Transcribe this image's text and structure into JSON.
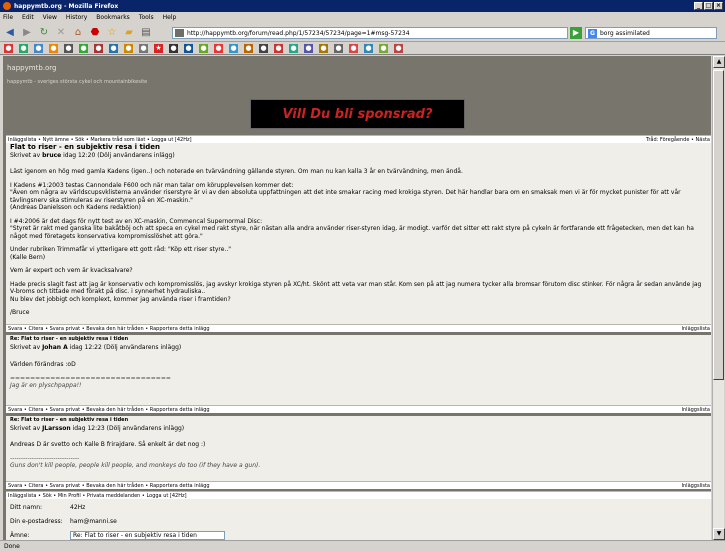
{
  "window": {
    "title": "happymtb.org - Mozilla Firefox",
    "min": "_",
    "max": "□",
    "close": "×"
  },
  "menu": [
    "File",
    "Edit",
    "View",
    "History",
    "Bookmarks",
    "Tools",
    "Help"
  ],
  "nav": {
    "url": "http://happymtb.org/forum/read.php/1/57234/57234/page=1#msg-57234",
    "search": "borg assimilated"
  },
  "site": {
    "title": "happymtb.org",
    "tagline": "happymtb - sveriges största cykel och mountainbikesite"
  },
  "banner": "Vill Du bli sponsrad?",
  "forumbar_top": {
    "left": "Inläggslista • Nytt ämne • Sök • Markera tråd som läst • Logga ut [42Hz]",
    "right": "Tråd: Föregående • Nästa"
  },
  "posts": [
    {
      "subject": "Flat to riser - en subjektiv resa i tiden",
      "by_prefix": "Skrivet av ",
      "author": "bruce",
      "by_suffix": " idag 12:20 (Dölj användarens inlägg)",
      "paragraphs": [
        "Läst igenom en hög med gamla Kadens (igen..) och noterade en tvärvändning gällande styren. Om man nu kan kalla 3 år en tvärvändning, men ändå.",
        "I Kadens #1:2003 testas Cannondale F600 och när man talar om körupplevelsen kommer det:\n\"Även om några av världscupsvklisterna använder riserstyre är vi av den absoluta uppfattningen att det inte smakar racing med krokiga styren. Det här handlar bara om en smaksak men vi är för mycket punister för att vår tävlingsnerv ska stimuleras av riserstyren på en XC-maskin.\"\n(Andreas Danielsson och Kadens redaktion)",
        "I #4:2006 är det dags för nytt test av en XC-maskin, Commencal Supernormal Disc:\n\"Styret är rakt med ganska lite bakåtböj och att speca en cykel med rakt styre, när nästan alla andra använder riser-styren idag, är modigt. varför det sitter ett rakt styre på cykeln är fortfarande ett frågetecken, men det kan ha något med företagets konservativa kompromisslöshet att göra.\"",
        "Under rubriken Trimmafår vi ytterligare ett gott råd: \"Köp ett riser styre..\"\n(Kalle Bern)",
        "Vem är expert och vem är kvacksalvare?",
        "Hade precis slagit fast att jag är konservativ och kompromisslös, jag avskyr krokiga styren på XC/ht. Skönt att veta var man står. Kom sen på att jag numera tycker alla bromsar förutom disc stinker. För några år sedan använde jag V-broms och tittade med förakt på disc. i synnerhet hydrauliska..\nNu blev det jobbigt och komplext, kommer jag använda riser i framtiden?",
        "/Bruce"
      ],
      "sig": "",
      "bar_left": "Svara • Citera • Svara privat • Bevaka den här tråden • Rapportera detta inlägg",
      "bar_right": "Inläggslista"
    },
    {
      "subject": "Re: Flat to riser - en subjektiv resa i tiden",
      "by_prefix": "Skrivet av ",
      "author": "Johan A",
      "by_suffix": " idag 12:22 (Dölj användarens inlägg)",
      "paragraphs": [
        "Världen förändras :oD"
      ],
      "sig": "================================\nJag är en plyschpappa!!",
      "bar_left": "Svara • Citera • Svara privat • Bevaka den här tråden • Rapportera detta inlägg",
      "bar_right": "Inläggslista"
    },
    {
      "subject": "Re: Flat to riser - en subjektiv resa i tiden",
      "by_prefix": "Skrivet av ",
      "author": "JLarsson",
      "by_suffix": " idag 12:23 (Dölj användarens inlägg)",
      "paragraphs": [
        "Andreas D är svetto och Kalle B frirajdare. Så enkelt är det nog :)"
      ],
      "sig": "--------------------------------\nGuns don't kill people, people kill people, and monkeys do too (if they have a gun).",
      "bar_left": "Svara • Citera • Svara privat • Bevaka den här tråden • Rapportera detta inlägg",
      "bar_right": "Inläggslista"
    }
  ],
  "forumbar_bottom": {
    "left": "Inläggslista • Sök • Min Profil • Privata meddelanden • Logga ut [42Hz]"
  },
  "reply": {
    "name_label": "Ditt namn:",
    "name_value": "42Hz",
    "email_label": "Din e-postadress:",
    "email_value": "ham@manni.se",
    "subject_label": "Ämne:",
    "subject_value": "Re: Flat to riser - en subjektiv resa i tiden"
  },
  "status": "Done",
  "colors": {
    "page_bg": "#77756c",
    "post_bg": "#efeee9",
    "banner_text": "#cc2222"
  }
}
